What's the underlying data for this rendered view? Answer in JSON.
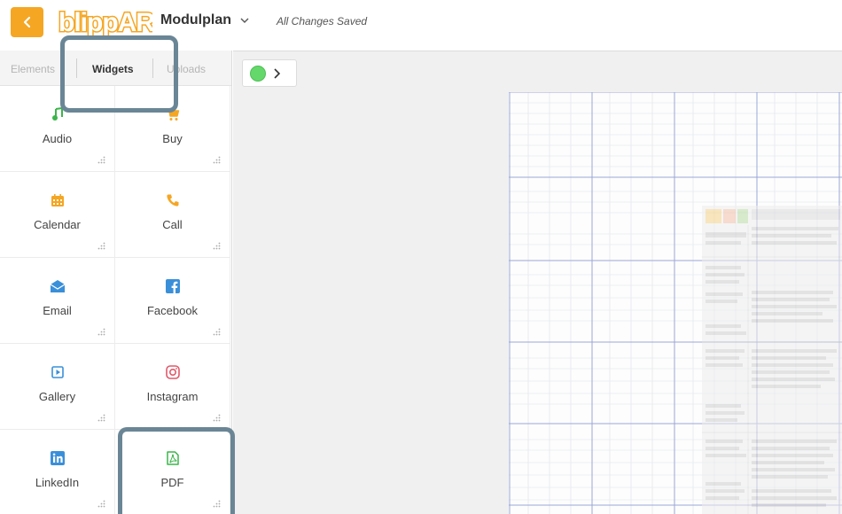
{
  "header": {
    "brand": "blippAR",
    "project_name": "Modulplan",
    "save_status": "All Changes Saved"
  },
  "sidebar": {
    "tabs": [
      {
        "label": "Elements",
        "active": false
      },
      {
        "label": "Widgets",
        "active": true
      },
      {
        "label": "Uploads",
        "active": false
      }
    ],
    "widgets": [
      {
        "label": "Audio",
        "icon": "music-note-icon",
        "color": "#3bb54a"
      },
      {
        "label": "Buy",
        "icon": "cart-icon",
        "color": "#f5a623"
      },
      {
        "label": "Calendar",
        "icon": "calendar-icon",
        "color": "#f5a623"
      },
      {
        "label": "Call",
        "icon": "phone-icon",
        "color": "#f5a623"
      },
      {
        "label": "Email",
        "icon": "envelope-icon",
        "color": "#3a8fd9"
      },
      {
        "label": "Facebook",
        "icon": "facebook-icon",
        "color": "#3a8fd9"
      },
      {
        "label": "Gallery",
        "icon": "gallery-icon",
        "color": "#3a8fd9"
      },
      {
        "label": "Instagram",
        "icon": "instagram-icon",
        "color": "#e05a6b"
      },
      {
        "label": "LinkedIn",
        "icon": "linkedin-icon",
        "color": "#3a8fd9"
      },
      {
        "label": "PDF",
        "icon": "pdf-icon",
        "color": "#3bb54a"
      }
    ]
  },
  "colors": {
    "accent": "#f5a623",
    "highlight": "#6a8696",
    "grid_line": "#9aa6d8"
  }
}
